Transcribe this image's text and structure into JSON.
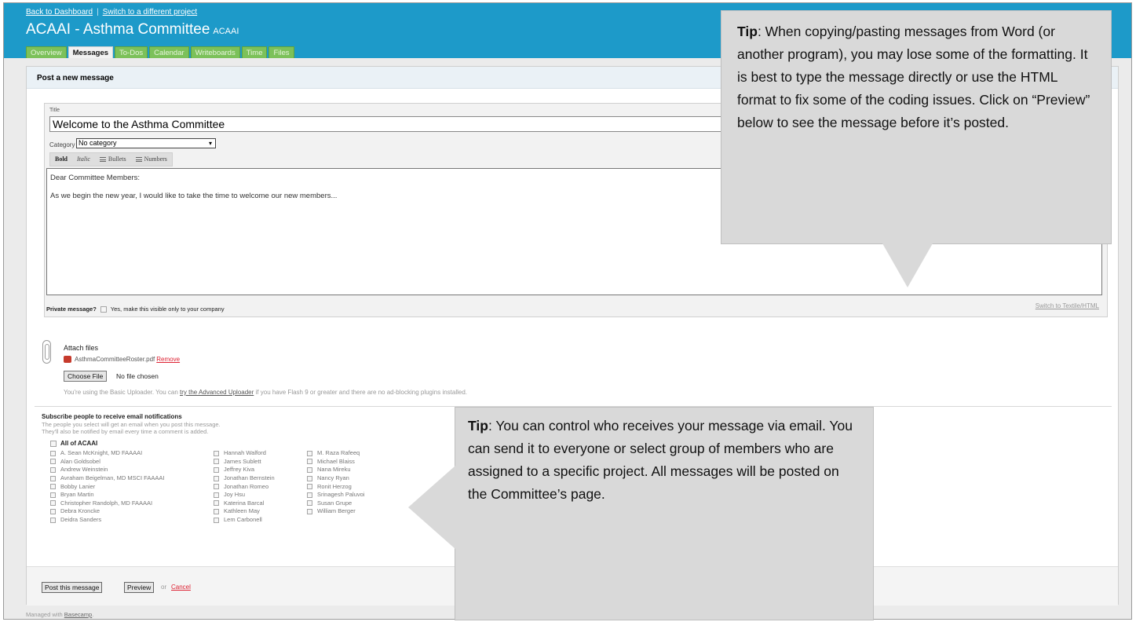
{
  "nav": {
    "back_link": "Back to Dashboard",
    "separator": "|",
    "switch_link": "Switch to a different project"
  },
  "project": {
    "title": "ACAAI - Asthma Committee",
    "company": "ACAAI"
  },
  "tabs": [
    {
      "label": "Overview",
      "active": false
    },
    {
      "label": "Messages",
      "active": true
    },
    {
      "label": "To-Dos",
      "active": false
    },
    {
      "label": "Calendar",
      "active": false
    },
    {
      "label": "Writeboards",
      "active": false
    },
    {
      "label": "Time",
      "active": false
    },
    {
      "label": "Files",
      "active": false
    }
  ],
  "panel": {
    "title": "Post a new message"
  },
  "editor": {
    "title_label": "Title",
    "title_value": "Welcome to the Asthma Committee",
    "category_label": "Category",
    "category_value": "No category",
    "format_buttons": [
      "Bold",
      "Italic",
      "Bullets",
      "Numbers"
    ],
    "body_line1": "Dear Committee Members:",
    "body_line2": "As we begin the new year, I would like to take the time to welcome our new members...",
    "private_label": "Private message?",
    "private_option": "Yes, make this visible only to your company",
    "switch_link": "Switch to Textile/HTML"
  },
  "attachments": {
    "title": "Attach files",
    "file_name": "AsthmaCommitteeRoster.pdf",
    "remove_link": "Remove",
    "choose_button": "Choose File",
    "no_file_text": "No file chosen",
    "note_before": "You're using the Basic Uploader. You can ",
    "note_link": "try the Advanced Uploader",
    "note_after": " if you have Flash 9 or greater and there are no ad-blocking plugins installed."
  },
  "subscribers": {
    "title": "Subscribe people to receive email notifications",
    "desc_line1": "The people you select will get an email when you post this message.",
    "desc_line2": "They'll also be notified by email every time a comment is added.",
    "all_label": "All of ACAAI",
    "columns": [
      [
        "A. Sean McKnight, MD FAAAAI",
        "Alan Goldsobel",
        "Andrew Weinstein",
        "Avraham Beigelman, MD MSCI FAAAAI",
        "Bobby Lanier",
        "Bryan Martin",
        "Christopher Randolph, MD FAAAAI",
        "Debra Kroncke",
        "Deidra Sanders"
      ],
      [
        "Hannah Walford",
        "James Sublett",
        "Jeffrey Kiva",
        "Jonathan Bernstein",
        "Jonathan Romeo",
        "Joy Hsu",
        "Katerina Barcal",
        "Kathleen May",
        "Lem Carbonell"
      ],
      [
        "M. Raza Rafeeq",
        "Michael Blaiss",
        "Nana Mireku",
        "Nancy Ryan",
        "Ronit Herzog",
        "Srinagesh Paluvoi",
        "Susan Grupe",
        "William Berger"
      ]
    ]
  },
  "actions": {
    "post_button": "Post this message",
    "preview_button": "Preview",
    "or_text": "or",
    "cancel_link": "Cancel"
  },
  "footer": {
    "managed_text": "Managed with ",
    "managed_link": "Basecamp",
    "managed_end": "."
  },
  "tips": {
    "tip1_label": "Tip",
    "tip1_text": ": When copying/pasting messages from Word (or another program), you may lose some of the formatting. It is best to type the message directly or use the HTML format to fix some of the coding issues. Click on “Preview” below to see the message before it’s posted.",
    "tip2_label": "Tip",
    "tip2_text": ": You can control who receives your message via email.  You can send it to everyone or select group of members who are assigned to a specific project.  All messages will be posted on the Committee’s page."
  },
  "colors": {
    "header_blue": "#1d9ac9",
    "tab_green": "#7cc15a",
    "link_red": "#dd2233",
    "tip_gray": "#d9d9d9"
  },
  "icons": [
    "paperclip-icon",
    "pdf-icon",
    "bullets-list-icon",
    "numbers-list-icon",
    "dropdown-arrow-icon"
  ]
}
